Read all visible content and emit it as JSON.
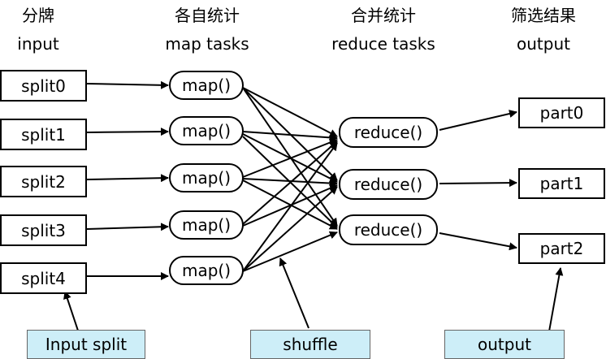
{
  "headers": {
    "input_cn": "分牌",
    "input_en": "input",
    "map_cn": "各自统计",
    "map_en": "map tasks",
    "reduce_cn": "合并统计",
    "reduce_en": "reduce tasks",
    "output_cn": "筛选结果",
    "output_en": "output"
  },
  "splits": [
    "split0",
    "split1",
    "split2",
    "split3",
    "split4"
  ],
  "maps": [
    "map()",
    "map()",
    "map()",
    "map()",
    "map()"
  ],
  "reduces": [
    "reduce()",
    "reduce()",
    "reduce()"
  ],
  "parts": [
    "part0",
    "part1",
    "part2"
  ],
  "notes": {
    "input_split": "Input split",
    "shuffle": "shuffle",
    "output": "output"
  },
  "colors": {
    "note_fill": "#cdeef8",
    "stroke": "#000000"
  }
}
